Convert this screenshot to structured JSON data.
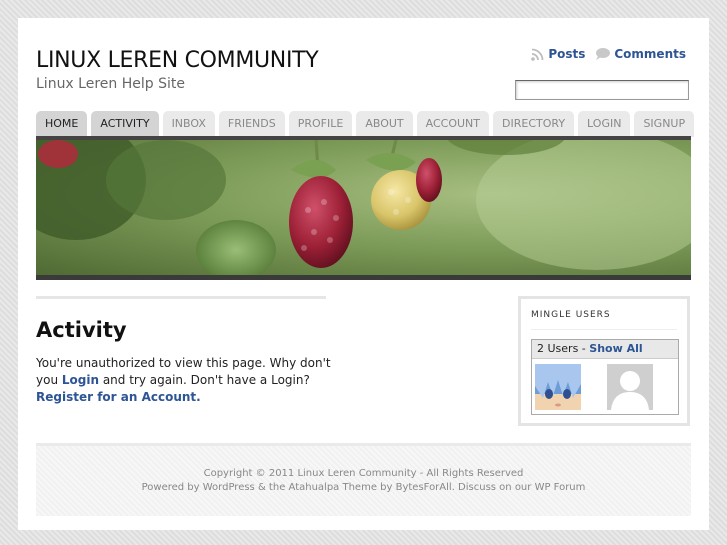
{
  "site": {
    "title": "LINUX LEREN COMMUNITY",
    "tagline": "Linux Leren Help Site"
  },
  "top_links": {
    "posts": "Posts",
    "comments": "Comments",
    "posts_icon": "rss-icon",
    "comments_icon": "comment-bubble-icon"
  },
  "search": {
    "value": "",
    "placeholder": ""
  },
  "nav": {
    "tabs": [
      {
        "label": "HOME",
        "active": true
      },
      {
        "label": "ACTIVITY",
        "active": true
      },
      {
        "label": "INBOX",
        "active": false
      },
      {
        "label": "FRIENDS",
        "active": false
      },
      {
        "label": "PROFILE",
        "active": false
      },
      {
        "label": "ABOUT",
        "active": false
      },
      {
        "label": "ACCOUNT",
        "active": false
      },
      {
        "label": "DIRECTORY",
        "active": false
      },
      {
        "label": "LOGIN",
        "active": false
      },
      {
        "label": "SIGNUP",
        "active": false
      }
    ]
  },
  "main": {
    "title": "Activity",
    "message_before": "You're unauthorized to view this page. Why don't you ",
    "login_link": "Login",
    "message_middle": " and try again. Don't have a Login?",
    "register_link": "Register for an Account."
  },
  "widget": {
    "title": "MINGLE USERS",
    "count_text": "2 Users - ",
    "show_all": "Show All"
  },
  "footer": {
    "copyright": "Copyright © 2011 Linux Leren Community - All Rights Reserved",
    "powered_prefix": "Powered by ",
    "wordpress": "WordPress",
    "powered_mid1": " & the ",
    "theme": "Atahualpa Theme",
    "powered_mid2": " by ",
    "author": "BytesForAll",
    "powered_mid3": ". Discuss on our ",
    "forum": "WP Forum"
  },
  "colors": {
    "link": "#2d5494",
    "nav_bar": "#444444",
    "tab_active": "#d4d4d4",
    "tab_inactive": "#eaeaea"
  }
}
